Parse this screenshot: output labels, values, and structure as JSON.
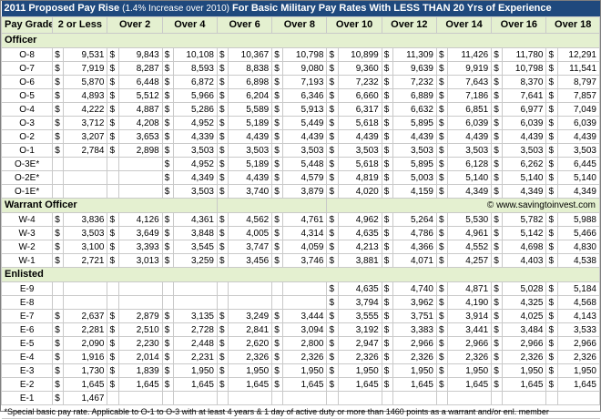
{
  "title": {
    "main": "2011 Proposed Pay Rise",
    "note": "(1.4% Increase over 2010)",
    "tail": "For Basic Military Pay Rates With LESS THAN 20 Yrs of Experience"
  },
  "columns": [
    "Pay Grade",
    "2 or Less",
    "Over 2",
    "Over 4",
    "Over 6",
    "Over 8",
    "Over 10",
    "Over 12",
    "Over 14",
    "Over 16",
    "Over 18"
  ],
  "currency_symbol": "$",
  "credit": "© www.savingtoinvest.com",
  "sections": [
    {
      "name": "Officer",
      "rows": [
        {
          "grade": "O-8",
          "values": [
            "9,531",
            "9,843",
            "10,108",
            "10,367",
            "10,798",
            "10,899",
            "11,309",
            "11,426",
            "11,780",
            "12,291"
          ]
        },
        {
          "grade": "O-7",
          "values": [
            "7,919",
            "8,287",
            "8,593",
            "8,838",
            "9,080",
            "9,360",
            "9,639",
            "9,919",
            "10,798",
            "11,541"
          ]
        },
        {
          "grade": "O-6",
          "values": [
            "5,870",
            "6,448",
            "6,872",
            "6,898",
            "7,193",
            "7,232",
            "7,232",
            "7,643",
            "8,370",
            "8,797"
          ]
        },
        {
          "grade": "O-5",
          "values": [
            "4,893",
            "5,512",
            "5,966",
            "6,204",
            "6,346",
            "6,660",
            "6,889",
            "7,186",
            "7,641",
            "7,857"
          ]
        },
        {
          "grade": "O-4",
          "values": [
            "4,222",
            "4,887",
            "5,286",
            "5,589",
            "5,913",
            "6,317",
            "6,632",
            "6,851",
            "6,977",
            "7,049"
          ]
        },
        {
          "grade": "O-3",
          "values": [
            "3,712",
            "4,208",
            "4,952",
            "5,189",
            "5,449",
            "5,618",
            "5,895",
            "6,039",
            "6,039",
            "6,039"
          ]
        },
        {
          "grade": "O-2",
          "values": [
            "3,207",
            "3,653",
            "4,339",
            "4,439",
            "4,439",
            "4,439",
            "4,439",
            "4,439",
            "4,439",
            "4,439"
          ]
        },
        {
          "grade": "O-1",
          "values": [
            "2,784",
            "2,898",
            "3,503",
            "3,503",
            "3,503",
            "3,503",
            "3,503",
            "3,503",
            "3,503",
            "3,503"
          ]
        },
        {
          "grade": "O-3E*",
          "values": [
            "",
            "",
            "4,952",
            "5,189",
            "5,448",
            "5,618",
            "5,895",
            "6,128",
            "6,262",
            "6,445"
          ]
        },
        {
          "grade": "O-2E*",
          "values": [
            "",
            "",
            "4,349",
            "4,439",
            "4,579",
            "4,819",
            "5,003",
            "5,140",
            "5,140",
            "5,140"
          ]
        },
        {
          "grade": "O-1E*",
          "values": [
            "",
            "",
            "3,503",
            "3,740",
            "3,879",
            "4,020",
            "4,159",
            "4,349",
            "4,349",
            "4,349"
          ]
        }
      ]
    },
    {
      "name": "Warrant Officer",
      "rows": [
        {
          "grade": "W-4",
          "values": [
            "3,836",
            "4,126",
            "4,361",
            "4,562",
            "4,761",
            "4,962",
            "5,264",
            "5,530",
            "5,782",
            "5,988"
          ]
        },
        {
          "grade": "W-3",
          "values": [
            "3,503",
            "3,649",
            "3,848",
            "4,005",
            "4,314",
            "4,635",
            "4,786",
            "4,961",
            "5,142",
            "5,466"
          ]
        },
        {
          "grade": "W-2",
          "values": [
            "3,100",
            "3,393",
            "3,545",
            "3,747",
            "4,059",
            "4,213",
            "4,366",
            "4,552",
            "4,698",
            "4,830"
          ]
        },
        {
          "grade": "W-1",
          "values": [
            "2,721",
            "3,013",
            "3,259",
            "3,456",
            "3,746",
            "3,881",
            "4,071",
            "4,257",
            "4,403",
            "4,538"
          ]
        }
      ]
    },
    {
      "name": "Enlisted",
      "rows": [
        {
          "grade": "E-9",
          "values": [
            "",
            "",
            "",
            "",
            "",
            "4,635",
            "4,740",
            "4,871",
            "5,028",
            "5,184"
          ]
        },
        {
          "grade": "E-8",
          "values": [
            "",
            "",
            "",
            "",
            "",
            "3,794",
            "3,962",
            "4,190",
            "4,325",
            "4,568"
          ]
        },
        {
          "grade": "E-7",
          "values": [
            "2,637",
            "2,879",
            "3,135",
            "3,249",
            "3,444",
            "3,555",
            "3,751",
            "3,914",
            "4,025",
            "4,143"
          ]
        },
        {
          "grade": "E-6",
          "values": [
            "2,281",
            "2,510",
            "2,728",
            "2,841",
            "3,094",
            "3,192",
            "3,383",
            "3,441",
            "3,484",
            "3,533"
          ]
        },
        {
          "grade": "E-5",
          "values": [
            "2,090",
            "2,230",
            "2,448",
            "2,620",
            "2,800",
            "2,947",
            "2,966",
            "2,966",
            "2,966",
            "2,966"
          ]
        },
        {
          "grade": "E-4",
          "values": [
            "1,916",
            "2,014",
            "2,231",
            "2,326",
            "2,326",
            "2,326",
            "2,326",
            "2,326",
            "2,326",
            "2,326"
          ]
        },
        {
          "grade": "E-3",
          "values": [
            "1,730",
            "1,839",
            "1,950",
            "1,950",
            "1,950",
            "1,950",
            "1,950",
            "1,950",
            "1,950",
            "1,950"
          ]
        },
        {
          "grade": "E-2",
          "values": [
            "1,645",
            "1,645",
            "1,645",
            "1,645",
            "1,645",
            "1,645",
            "1,645",
            "1,645",
            "1,645",
            "1,645"
          ]
        },
        {
          "grade": "E-1",
          "values": [
            "1,467",
            "",
            "",
            "",
            "",
            "",
            "",
            "",
            "",
            ""
          ]
        }
      ]
    }
  ],
  "footnote": "*Special basic pay rate. Applicable to O-1 to O-3 with at least 4 years & 1 day of active duty or more than 1460 points as a warrant and/or enl. member"
}
